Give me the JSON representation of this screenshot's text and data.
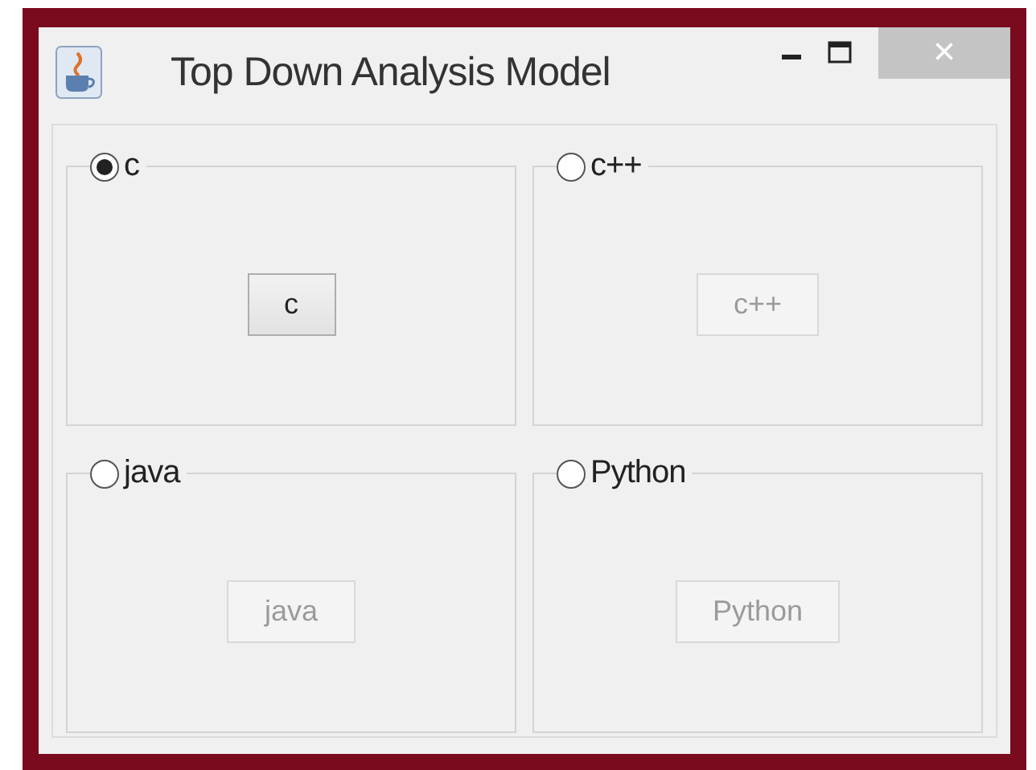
{
  "window": {
    "title": "Top Down Analysis Model",
    "close_symbol": "×"
  },
  "panels": [
    {
      "radio": {
        "label": "c",
        "selected": true
      },
      "button": {
        "label": "c",
        "disabled": false
      }
    },
    {
      "radio": {
        "label": "c++",
        "selected": false
      },
      "button": {
        "label": "c++",
        "disabled": true
      }
    },
    {
      "radio": {
        "label": "java",
        "selected": false
      },
      "button": {
        "label": "java",
        "disabled": true
      }
    },
    {
      "radio": {
        "label": "Python",
        "selected": false
      },
      "button": {
        "label": "Python",
        "disabled": true
      }
    }
  ]
}
